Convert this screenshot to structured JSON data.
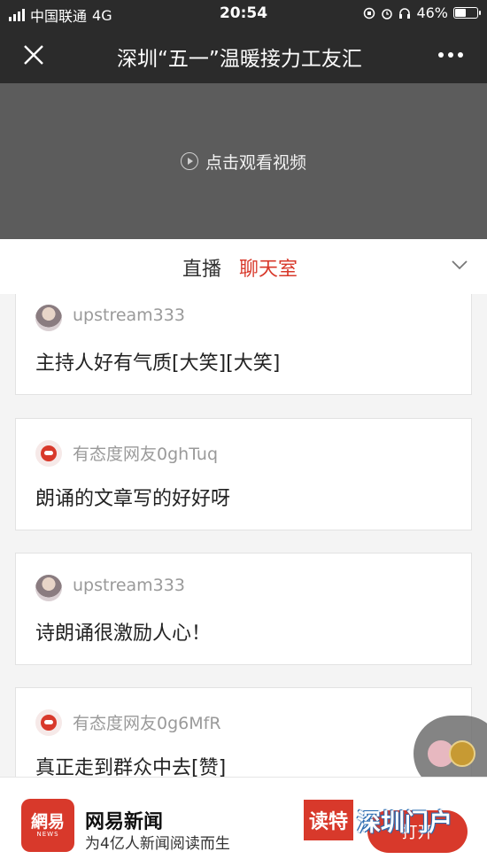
{
  "status_bar": {
    "carrier": "中国联通",
    "network": "4G",
    "time": "20:54",
    "battery": "46%"
  },
  "nav": {
    "title": "深圳“五一”温暖接力工友汇",
    "close_icon": "close-icon",
    "more_icon": "more-icon"
  },
  "video": {
    "play_label": "点击观看视频"
  },
  "tabs": {
    "live": "直播",
    "chat": "聊天室",
    "active": "chat"
  },
  "comments": [
    {
      "user": "upstream333",
      "avatar": "user-photo",
      "text": "主持人好有气质[大笑][大笑]"
    },
    {
      "user": "有态度网友0ghTuq",
      "avatar": "netease-logo",
      "text": "朗诵的文章写的好好呀"
    },
    {
      "user": "upstream333",
      "avatar": "user-photo",
      "text": "诗朗诵很激励人心！"
    },
    {
      "user": "有态度网友0g6MfR",
      "avatar": "netease-logo",
      "text": "真正走到群众中去[赞]"
    }
  ],
  "app_banner": {
    "logo_text": "網易",
    "logo_sub": "NEWS",
    "name": "网易新闻",
    "slogan": "为4亿人新闻阅读而生",
    "open_button": "打开"
  },
  "watermark": {
    "part1": "读特",
    "part2": "深圳门户"
  },
  "colors": {
    "accent": "#d8392b",
    "nav_bg": "#2b2b2b",
    "video_bg": "#5c5c5c"
  }
}
